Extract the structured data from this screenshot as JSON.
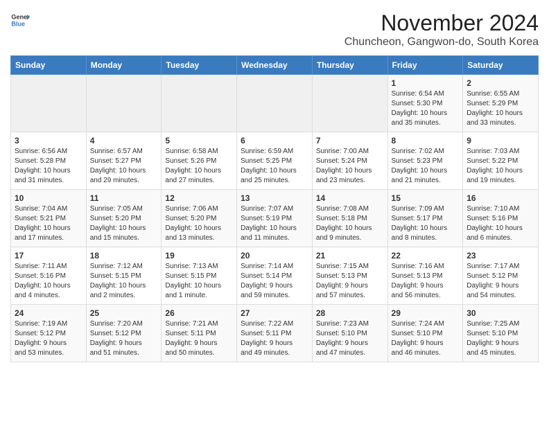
{
  "header": {
    "logo_line1": "General",
    "logo_line2": "Blue",
    "title": "November 2024",
    "subtitle": "Chuncheon, Gangwon-do, South Korea"
  },
  "weekdays": [
    "Sunday",
    "Monday",
    "Tuesday",
    "Wednesday",
    "Thursday",
    "Friday",
    "Saturday"
  ],
  "weeks": [
    [
      {
        "day": "",
        "info": ""
      },
      {
        "day": "",
        "info": ""
      },
      {
        "day": "",
        "info": ""
      },
      {
        "day": "",
        "info": ""
      },
      {
        "day": "",
        "info": ""
      },
      {
        "day": "1",
        "info": "Sunrise: 6:54 AM\nSunset: 5:30 PM\nDaylight: 10 hours\nand 35 minutes."
      },
      {
        "day": "2",
        "info": "Sunrise: 6:55 AM\nSunset: 5:29 PM\nDaylight: 10 hours\nand 33 minutes."
      }
    ],
    [
      {
        "day": "3",
        "info": "Sunrise: 6:56 AM\nSunset: 5:28 PM\nDaylight: 10 hours\nand 31 minutes."
      },
      {
        "day": "4",
        "info": "Sunrise: 6:57 AM\nSunset: 5:27 PM\nDaylight: 10 hours\nand 29 minutes."
      },
      {
        "day": "5",
        "info": "Sunrise: 6:58 AM\nSunset: 5:26 PM\nDaylight: 10 hours\nand 27 minutes."
      },
      {
        "day": "6",
        "info": "Sunrise: 6:59 AM\nSunset: 5:25 PM\nDaylight: 10 hours\nand 25 minutes."
      },
      {
        "day": "7",
        "info": "Sunrise: 7:00 AM\nSunset: 5:24 PM\nDaylight: 10 hours\nand 23 minutes."
      },
      {
        "day": "8",
        "info": "Sunrise: 7:02 AM\nSunset: 5:23 PM\nDaylight: 10 hours\nand 21 minutes."
      },
      {
        "day": "9",
        "info": "Sunrise: 7:03 AM\nSunset: 5:22 PM\nDaylight: 10 hours\nand 19 minutes."
      }
    ],
    [
      {
        "day": "10",
        "info": "Sunrise: 7:04 AM\nSunset: 5:21 PM\nDaylight: 10 hours\nand 17 minutes."
      },
      {
        "day": "11",
        "info": "Sunrise: 7:05 AM\nSunset: 5:20 PM\nDaylight: 10 hours\nand 15 minutes."
      },
      {
        "day": "12",
        "info": "Sunrise: 7:06 AM\nSunset: 5:20 PM\nDaylight: 10 hours\nand 13 minutes."
      },
      {
        "day": "13",
        "info": "Sunrise: 7:07 AM\nSunset: 5:19 PM\nDaylight: 10 hours\nand 11 minutes."
      },
      {
        "day": "14",
        "info": "Sunrise: 7:08 AM\nSunset: 5:18 PM\nDaylight: 10 hours\nand 9 minutes."
      },
      {
        "day": "15",
        "info": "Sunrise: 7:09 AM\nSunset: 5:17 PM\nDaylight: 10 hours\nand 8 minutes."
      },
      {
        "day": "16",
        "info": "Sunrise: 7:10 AM\nSunset: 5:16 PM\nDaylight: 10 hours\nand 6 minutes."
      }
    ],
    [
      {
        "day": "17",
        "info": "Sunrise: 7:11 AM\nSunset: 5:16 PM\nDaylight: 10 hours\nand 4 minutes."
      },
      {
        "day": "18",
        "info": "Sunrise: 7:12 AM\nSunset: 5:15 PM\nDaylight: 10 hours\nand 2 minutes."
      },
      {
        "day": "19",
        "info": "Sunrise: 7:13 AM\nSunset: 5:15 PM\nDaylight: 10 hours\nand 1 minute."
      },
      {
        "day": "20",
        "info": "Sunrise: 7:14 AM\nSunset: 5:14 PM\nDaylight: 9 hours\nand 59 minutes."
      },
      {
        "day": "21",
        "info": "Sunrise: 7:15 AM\nSunset: 5:13 PM\nDaylight: 9 hours\nand 57 minutes."
      },
      {
        "day": "22",
        "info": "Sunrise: 7:16 AM\nSunset: 5:13 PM\nDaylight: 9 hours\nand 56 minutes."
      },
      {
        "day": "23",
        "info": "Sunrise: 7:17 AM\nSunset: 5:12 PM\nDaylight: 9 hours\nand 54 minutes."
      }
    ],
    [
      {
        "day": "24",
        "info": "Sunrise: 7:19 AM\nSunset: 5:12 PM\nDaylight: 9 hours\nand 53 minutes."
      },
      {
        "day": "25",
        "info": "Sunrise: 7:20 AM\nSunset: 5:12 PM\nDaylight: 9 hours\nand 51 minutes."
      },
      {
        "day": "26",
        "info": "Sunrise: 7:21 AM\nSunset: 5:11 PM\nDaylight: 9 hours\nand 50 minutes."
      },
      {
        "day": "27",
        "info": "Sunrise: 7:22 AM\nSunset: 5:11 PM\nDaylight: 9 hours\nand 49 minutes."
      },
      {
        "day": "28",
        "info": "Sunrise: 7:23 AM\nSunset: 5:10 PM\nDaylight: 9 hours\nand 47 minutes."
      },
      {
        "day": "29",
        "info": "Sunrise: 7:24 AM\nSunset: 5:10 PM\nDaylight: 9 hours\nand 46 minutes."
      },
      {
        "day": "30",
        "info": "Sunrise: 7:25 AM\nSunset: 5:10 PM\nDaylight: 9 hours\nand 45 minutes."
      }
    ]
  ]
}
